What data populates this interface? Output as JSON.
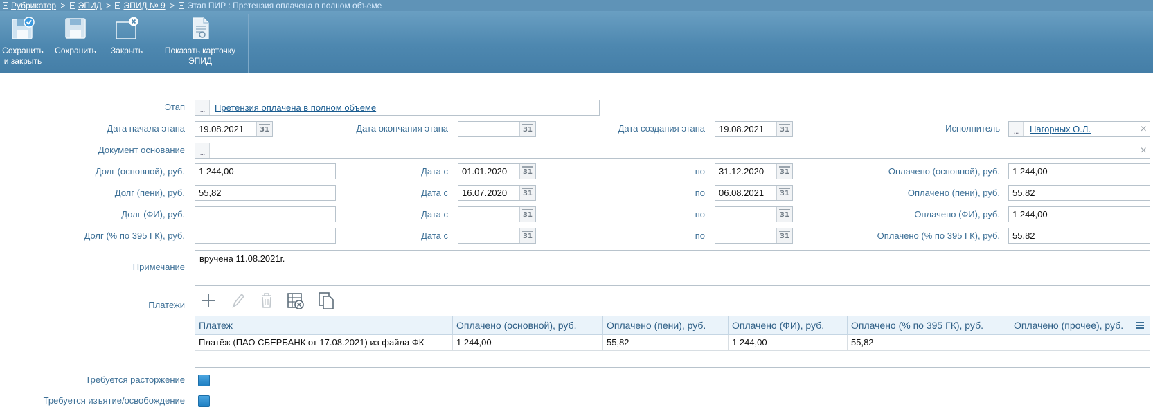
{
  "breadcrumb": {
    "items": [
      "Рубрикатор",
      "ЭПИД",
      "ЭПИД № 9"
    ],
    "separator": ">",
    "current": "Этап ПИР : Претензия оплачена в полном объеме"
  },
  "toolbar": {
    "save_close": "Сохранить и закрыть",
    "save": "Сохранить",
    "close": "Закрыть",
    "show_card": "Показать карточку ЭПИД"
  },
  "form": {
    "stage_label": "Этап",
    "stage_value": "Претензия оплачена в полном объеме",
    "start_date_label": "Дата начала этапа",
    "start_date": "19.08.2021",
    "end_date_label": "Дата окончания этапа",
    "end_date": "",
    "created_date_label": "Дата создания этапа",
    "created_date": "19.08.2021",
    "executor_label": "Исполнитель",
    "executor": "Нагорных О.Л.",
    "basis_doc_label": "Документ основание",
    "basis_doc": "",
    "rows": [
      {
        "debt_label": "Долг (основной), руб.",
        "debt": "1 244,00",
        "from_label": "Дата с",
        "from": "01.01.2020",
        "to_label": "по",
        "to": "31.12.2020",
        "paid_label": "Оплачено (основной), руб.",
        "paid": "1 244,00"
      },
      {
        "debt_label": "Долг (пени), руб.",
        "debt": "55,82",
        "from_label": "Дата с",
        "from": "16.07.2020",
        "to_label": "по",
        "to": "06.08.2021",
        "paid_label": "Оплачено (пени), руб.",
        "paid": "55,82"
      },
      {
        "debt_label": "Долг (ФИ), руб.",
        "debt": "",
        "from_label": "Дата с",
        "from": "",
        "to_label": "по",
        "to": "",
        "paid_label": "Оплачено (ФИ), руб.",
        "paid": "1 244,00"
      },
      {
        "debt_label": "Долг (% по 395 ГК), руб.",
        "debt": "",
        "from_label": "Дата с",
        "from": "",
        "to_label": "по",
        "to": "",
        "paid_label": "Оплачено (% по 395 ГК), руб.",
        "paid": "55,82"
      }
    ],
    "note_label": "Примечание",
    "note": "вручена 11.08.2021г.",
    "payments_label": "Платежи",
    "calendar_glyph": "31",
    "dots": "...",
    "clear": "×",
    "requires_termination_label": "Требуется расторжение",
    "requires_seizure_label": "Требуется изъятие/освобождение"
  },
  "payments": {
    "columns": [
      "Платеж",
      "Оплачено (основной), руб.",
      "Оплачено (пени), руб.",
      "Оплачено (ФИ), руб.",
      "Оплачено (% по 395 ГК), руб.",
      "Оплачено (прочее), руб."
    ],
    "rows": [
      [
        "Платёж (ПАО СБЕРБАНК от 17.08.2021) из файла ФК",
        "1 244,00",
        "55,82",
        "1 244,00",
        "55,82",
        ""
      ]
    ]
  },
  "colors": {
    "toolbar": "#4e88b0",
    "label": "#3c6f96",
    "link": "#1b5d91",
    "checkbox": "#1f7fc2"
  }
}
